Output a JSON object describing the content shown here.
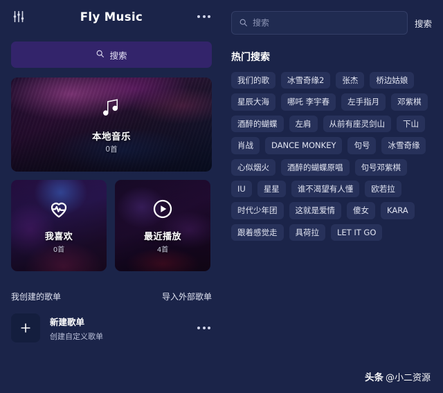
{
  "left_panel": {
    "settings_icon": "sliders-icon",
    "title": "Fly Music",
    "more_icon": "more-horizontal-icon",
    "search_button": {
      "label": "搜索",
      "icon": "search-icon"
    },
    "cards": [
      {
        "id": "local-music",
        "icon": "music-note-icon",
        "title": "本地音乐",
        "count": "0首"
      },
      {
        "id": "favorites",
        "icon": "heart-pulse-icon",
        "title": "我喜欢",
        "count": "0首"
      },
      {
        "id": "recently-played",
        "icon": "play-circle-icon",
        "title": "最近播放",
        "count": "4首"
      }
    ],
    "playlists": {
      "section_label": "我创建的歌单",
      "import_action": "导入外部歌单",
      "new_playlist": {
        "icon": "plus-icon",
        "title": "新建歌单",
        "subtitle": "创建自定义歌单",
        "more_icon": "more-horizontal-icon"
      }
    }
  },
  "right_panel": {
    "search": {
      "icon": "search-icon",
      "value": "",
      "placeholder": "搜索",
      "button_label": "搜索"
    },
    "hot_searches": {
      "title": "热门搜索",
      "tags": [
        "我们的歌",
        "冰雪奇缘2",
        "张杰",
        "桥边姑娘",
        "星辰大海",
        "哪吒 李宇春",
        "左手指月",
        "邓紫棋",
        "酒醉的蝴蝶",
        "左肩",
        "从前有座灵剑山",
        "下山",
        "肖战",
        "DANCE MONKEY",
        "句号",
        "冰雪奇缘",
        "心似烟火",
        "酒醉的蝴蝶原唱",
        "句号邓紫棋",
        "IU",
        "星星",
        "谁不渴望有人懂",
        "欧若拉",
        "时代少年团",
        "这就是爱情",
        "傻女",
        "KARA",
        "跟着感觉走",
        "具荷拉",
        "LET IT GO"
      ]
    }
  },
  "watermark": {
    "brand": "头条",
    "handle": "@小二资源"
  },
  "colors": {
    "background": "#1b2449",
    "accent_purple": "#33246b",
    "tag_background": "#27315a",
    "text_primary": "#ffffff"
  }
}
